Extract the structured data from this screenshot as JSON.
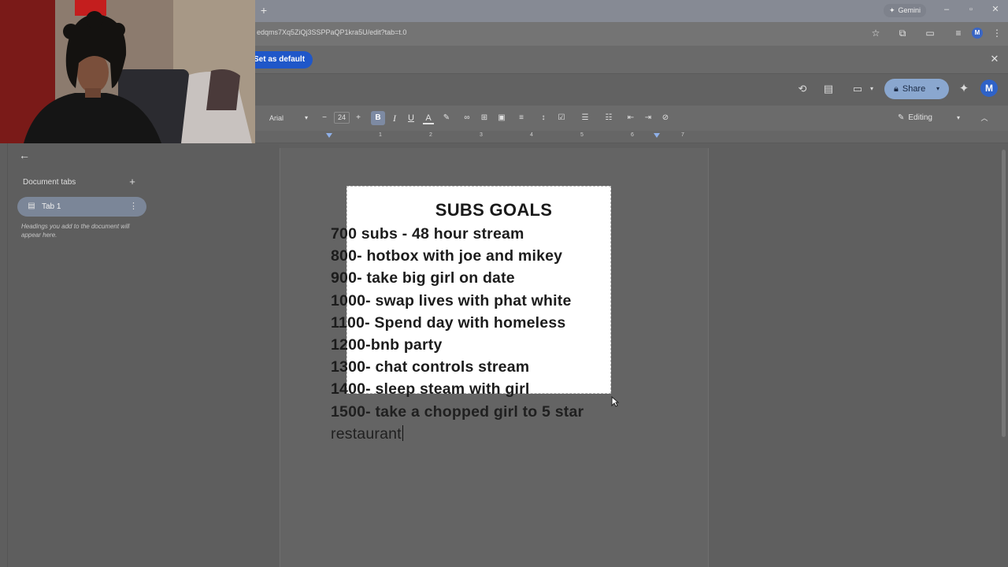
{
  "browser": {
    "new_tab_glyph": "+",
    "gemini_label": "Gemini",
    "url": "edqms7Xq5ZiQj3SSPPaQP1kra5U/edit?tab=t.0",
    "set_default_label": "Set as default"
  },
  "docs": {
    "share_label": "Share",
    "user_initial": "M",
    "font_name": "Arial",
    "font_size": "24",
    "editing_label": "Editing"
  },
  "ruler": [
    "1",
    "2",
    "3",
    "4",
    "5",
    "6",
    "7"
  ],
  "left_panel": {
    "document_tabs_label": "Document tabs",
    "tab_label": "Tab 1",
    "hint": "Headings you add to the document will appear here."
  },
  "doc": {
    "title": "SUBS GOALS",
    "lines": [
      "700 subs - 48 hour stream",
      "800- hotbox with joe and mikey",
      "900- take big girl on date",
      "1000- swap lives with phat white",
      "1100- Spend day with homeless",
      "1200-bnb party",
      "1300- chat controls stream",
      "1400- sleep steam with girl",
      "1500- take a chopped girl to 5 star",
      "restaurant"
    ]
  },
  "colors": {
    "accent": "#1f57c9",
    "share_bg": "#8aa7cf",
    "avatar": "#2f62c7"
  }
}
